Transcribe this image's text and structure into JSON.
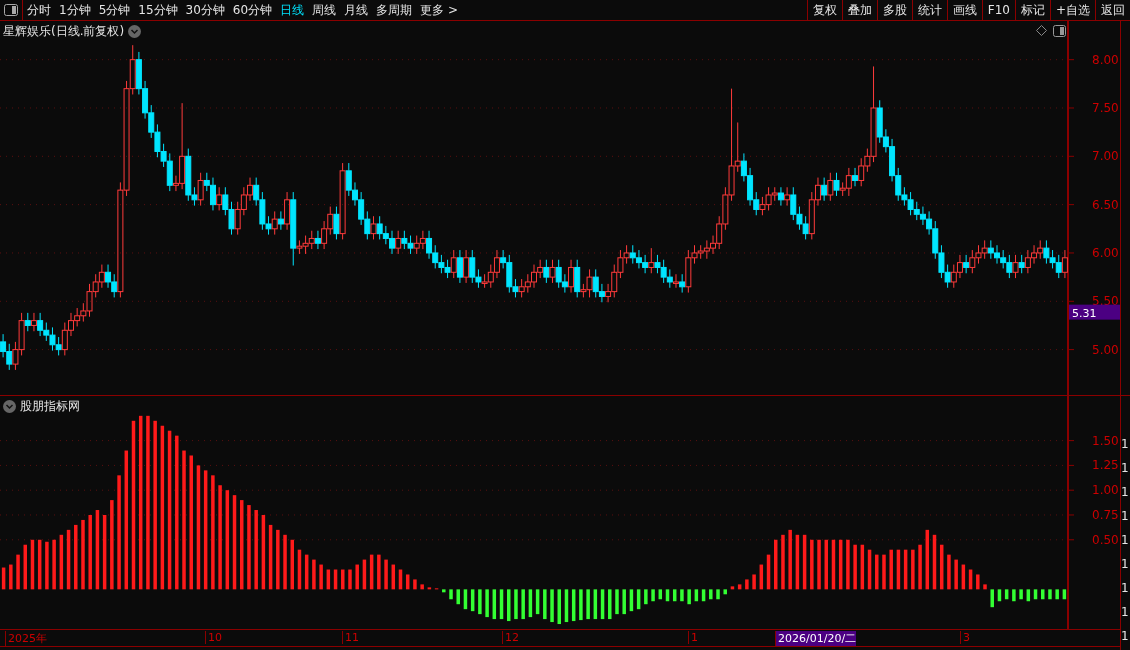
{
  "toolbar": {
    "periods": [
      {
        "label": "分时",
        "selected": false
      },
      {
        "label": "1分钟",
        "selected": false
      },
      {
        "label": "5分钟",
        "selected": false
      },
      {
        "label": "15分钟",
        "selected": false
      },
      {
        "label": "30分钟",
        "selected": false
      },
      {
        "label": "60分钟",
        "selected": false
      },
      {
        "label": "日线",
        "selected": true
      },
      {
        "label": "周线",
        "selected": false
      },
      {
        "label": "月线",
        "selected": false
      },
      {
        "label": "多周期",
        "selected": false
      },
      {
        "label": "更多 >",
        "selected": false
      }
    ],
    "buttons": [
      "复权",
      "叠加",
      "多股",
      "统计",
      "画线",
      "F10",
      "标记",
      "+自选",
      "返回"
    ]
  },
  "main_chart": {
    "title": "星辉娱乐(日线.前复权)",
    "price_tag": "5.31",
    "chart_data": {
      "type": "candlestick",
      "grid": true,
      "ylim": [
        4.52,
        8.4
      ],
      "yticks": [
        {
          "value": 8,
          "label": "8.00"
        },
        {
          "value": 7.5,
          "label": "7.50"
        },
        {
          "value": 7,
          "label": "7.00"
        },
        {
          "value": 6.5,
          "label": "6.50"
        },
        {
          "value": 6,
          "label": "6.00"
        },
        {
          "value": 5.5,
          "label": "5.50"
        },
        {
          "value": 5,
          "label": "5.00"
        }
      ],
      "ohlc": [
        [
          5.08,
          5.16,
          4.92,
          4.98
        ],
        [
          4.98,
          5.06,
          4.79,
          4.85
        ],
        [
          4.85,
          5.08,
          4.79,
          5.0
        ],
        [
          5.0,
          5.38,
          4.94,
          5.3
        ],
        [
          5.3,
          5.38,
          5.19,
          5.25
        ],
        [
          5.25,
          5.38,
          5.19,
          5.3
        ],
        [
          5.3,
          5.38,
          5.14,
          5.2
        ],
        [
          5.2,
          5.28,
          5.09,
          5.15
        ],
        [
          5.15,
          5.23,
          4.99,
          5.05
        ],
        [
          5.05,
          5.13,
          4.94,
          5.0
        ],
        [
          5.0,
          5.28,
          4.94,
          5.2
        ],
        [
          5.2,
          5.38,
          5.14,
          5.3
        ],
        [
          5.3,
          5.43,
          5.24,
          5.35
        ],
        [
          5.35,
          5.48,
          5.29,
          5.4
        ],
        [
          5.4,
          5.68,
          5.34,
          5.6
        ],
        [
          5.6,
          5.78,
          5.54,
          5.7
        ],
        [
          5.7,
          5.88,
          5.64,
          5.8
        ],
        [
          5.8,
          5.88,
          5.64,
          5.7
        ],
        [
          5.7,
          5.78,
          5.54,
          5.6
        ],
        [
          5.6,
          6.73,
          5.54,
          6.65
        ],
        [
          6.65,
          7.78,
          6.59,
          7.7
        ],
        [
          7.7,
          8.15,
          7.64,
          8.0
        ],
        [
          8.0,
          8.08,
          7.64,
          7.7
        ],
        [
          7.7,
          7.78,
          7.39,
          7.45
        ],
        [
          7.45,
          7.53,
          7.19,
          7.25
        ],
        [
          7.25,
          7.33,
          6.99,
          7.05
        ],
        [
          7.05,
          7.13,
          6.89,
          6.95
        ],
        [
          6.95,
          7.03,
          6.64,
          6.7
        ],
        [
          6.7,
          6.8,
          6.64,
          6.72
        ],
        [
          6.72,
          7.55,
          6.66,
          7.0
        ],
        [
          7.0,
          7.08,
          6.54,
          6.6
        ],
        [
          6.6,
          6.68,
          6.49,
          6.55
        ],
        [
          6.55,
          6.83,
          6.49,
          6.75
        ],
        [
          6.75,
          6.83,
          6.64,
          6.7
        ],
        [
          6.7,
          6.78,
          6.44,
          6.5
        ],
        [
          6.5,
          6.68,
          6.44,
          6.6
        ],
        [
          6.6,
          6.68,
          6.39,
          6.45
        ],
        [
          6.45,
          6.53,
          6.19,
          6.25
        ],
        [
          6.25,
          6.53,
          6.19,
          6.45
        ],
        [
          6.45,
          6.68,
          6.39,
          6.6
        ],
        [
          6.6,
          6.78,
          6.54,
          6.7
        ],
        [
          6.7,
          6.78,
          6.49,
          6.55
        ],
        [
          6.55,
          6.63,
          6.24,
          6.3
        ],
        [
          6.3,
          6.38,
          6.19,
          6.25
        ],
        [
          6.25,
          6.43,
          6.19,
          6.35
        ],
        [
          6.35,
          6.43,
          6.24,
          6.3
        ],
        [
          6.3,
          6.63,
          6.24,
          6.55
        ],
        [
          6.55,
          6.63,
          5.87,
          6.05
        ],
        [
          6.05,
          6.13,
          5.99,
          6.07
        ],
        [
          6.07,
          6.18,
          5.99,
          6.1
        ],
        [
          6.1,
          6.23,
          6.04,
          6.15
        ],
        [
          6.15,
          6.23,
          6.04,
          6.1
        ],
        [
          6.1,
          6.33,
          6.04,
          6.25
        ],
        [
          6.25,
          6.48,
          6.19,
          6.4
        ],
        [
          6.4,
          6.48,
          6.14,
          6.2
        ],
        [
          6.2,
          6.93,
          6.14,
          6.85
        ],
        [
          6.85,
          6.93,
          6.59,
          6.65
        ],
        [
          6.65,
          6.73,
          6.49,
          6.55
        ],
        [
          6.55,
          6.63,
          6.29,
          6.35
        ],
        [
          6.35,
          6.43,
          6.14,
          6.2
        ],
        [
          6.2,
          6.38,
          6.14,
          6.3
        ],
        [
          6.3,
          6.38,
          6.14,
          6.2
        ],
        [
          6.2,
          6.28,
          6.09,
          6.15
        ],
        [
          6.15,
          6.23,
          5.99,
          6.05
        ],
        [
          6.05,
          6.23,
          5.99,
          6.15
        ],
        [
          6.15,
          6.23,
          6.04,
          6.1
        ],
        [
          6.1,
          6.18,
          5.99,
          6.05
        ],
        [
          6.05,
          6.18,
          5.99,
          6.1
        ],
        [
          6.1,
          6.23,
          6.04,
          6.15
        ],
        [
          6.15,
          6.23,
          5.94,
          6.0
        ],
        [
          6.0,
          6.08,
          5.84,
          5.9
        ],
        [
          5.9,
          5.98,
          5.79,
          5.85
        ],
        [
          5.85,
          5.93,
          5.74,
          5.8
        ],
        [
          5.8,
          6.03,
          5.74,
          5.95
        ],
        [
          5.95,
          6.03,
          5.69,
          5.75
        ],
        [
          5.75,
          6.03,
          5.69,
          5.95
        ],
        [
          5.95,
          6.03,
          5.69,
          5.75
        ],
        [
          5.75,
          5.83,
          5.64,
          5.7
        ],
        [
          5.7,
          5.78,
          5.64,
          5.7
        ],
        [
          5.7,
          5.88,
          5.64,
          5.8
        ],
        [
          5.8,
          6.03,
          5.74,
          5.95
        ],
        [
          5.95,
          6.03,
          5.84,
          5.9
        ],
        [
          5.9,
          5.98,
          5.59,
          5.65
        ],
        [
          5.65,
          5.73,
          5.54,
          5.6
        ],
        [
          5.6,
          5.73,
          5.54,
          5.65
        ],
        [
          5.65,
          5.78,
          5.59,
          5.7
        ],
        [
          5.7,
          5.88,
          5.64,
          5.8
        ],
        [
          5.8,
          5.93,
          5.74,
          5.85
        ],
        [
          5.85,
          5.93,
          5.69,
          5.75
        ],
        [
          5.75,
          5.93,
          5.69,
          5.85
        ],
        [
          5.85,
          5.93,
          5.64,
          5.7
        ],
        [
          5.7,
          5.78,
          5.59,
          5.65
        ],
        [
          5.65,
          5.93,
          5.59,
          5.85
        ],
        [
          5.85,
          5.93,
          5.54,
          5.6
        ],
        [
          5.6,
          5.68,
          5.54,
          5.62
        ],
        [
          5.62,
          5.83,
          5.54,
          5.75
        ],
        [
          5.75,
          5.83,
          5.54,
          5.6
        ],
        [
          5.6,
          5.68,
          5.49,
          5.55
        ],
        [
          5.55,
          5.68,
          5.49,
          5.6
        ],
        [
          5.6,
          5.88,
          5.54,
          5.8
        ],
        [
          5.8,
          6.03,
          5.74,
          5.95
        ],
        [
          5.95,
          6.08,
          5.89,
          6.0
        ],
        [
          6.0,
          6.08,
          5.89,
          5.95
        ],
        [
          5.95,
          6.03,
          5.84,
          5.9
        ],
        [
          5.9,
          5.98,
          5.79,
          5.85
        ],
        [
          5.85,
          6.05,
          5.79,
          5.9
        ],
        [
          5.9,
          5.98,
          5.79,
          5.85
        ],
        [
          5.85,
          5.93,
          5.69,
          5.75
        ],
        [
          5.75,
          5.83,
          5.64,
          5.7
        ],
        [
          5.7,
          5.78,
          5.64,
          5.7
        ],
        [
          5.7,
          5.78,
          5.59,
          5.65
        ],
        [
          5.65,
          6.03,
          5.59,
          5.95
        ],
        [
          5.95,
          6.08,
          5.89,
          6.0
        ],
        [
          6.0,
          6.08,
          5.94,
          6.02
        ],
        [
          6.02,
          6.13,
          5.94,
          6.05
        ],
        [
          6.05,
          6.18,
          5.99,
          6.1
        ],
        [
          6.1,
          6.38,
          6.04,
          6.3
        ],
        [
          6.3,
          6.68,
          6.24,
          6.6
        ],
        [
          6.6,
          7.7,
          6.54,
          6.9
        ],
        [
          6.9,
          7.35,
          6.84,
          6.95
        ],
        [
          6.95,
          7.03,
          6.74,
          6.8
        ],
        [
          6.8,
          6.88,
          6.49,
          6.55
        ],
        [
          6.55,
          6.63,
          6.39,
          6.45
        ],
        [
          6.45,
          6.58,
          6.39,
          6.5
        ],
        [
          6.5,
          6.68,
          6.44,
          6.6
        ],
        [
          6.6,
          6.68,
          6.54,
          6.62
        ],
        [
          6.62,
          6.68,
          6.49,
          6.55
        ],
        [
          6.55,
          6.68,
          6.49,
          6.6
        ],
        [
          6.6,
          6.68,
          6.34,
          6.4
        ],
        [
          6.4,
          6.48,
          6.24,
          6.3
        ],
        [
          6.3,
          6.38,
          6.14,
          6.2
        ],
        [
          6.2,
          6.63,
          6.14,
          6.55
        ],
        [
          6.55,
          6.78,
          6.49,
          6.7
        ],
        [
          6.7,
          6.78,
          6.54,
          6.6
        ],
        [
          6.6,
          6.83,
          6.54,
          6.75
        ],
        [
          6.75,
          6.83,
          6.59,
          6.65
        ],
        [
          6.65,
          6.73,
          6.59,
          6.67
        ],
        [
          6.67,
          6.88,
          6.59,
          6.8
        ],
        [
          6.8,
          6.88,
          6.69,
          6.75
        ],
        [
          6.75,
          6.98,
          6.69,
          6.9
        ],
        [
          6.9,
          7.08,
          6.84,
          7.0
        ],
        [
          7.0,
          7.93,
          6.94,
          7.5
        ],
        [
          7.5,
          7.58,
          7.14,
          7.2
        ],
        [
          7.2,
          7.28,
          7.04,
          7.1
        ],
        [
          7.1,
          7.18,
          6.74,
          6.8
        ],
        [
          6.8,
          6.88,
          6.54,
          6.6
        ],
        [
          6.6,
          6.68,
          6.49,
          6.55
        ],
        [
          6.55,
          6.63,
          6.39,
          6.45
        ],
        [
          6.45,
          6.53,
          6.34,
          6.4
        ],
        [
          6.4,
          6.48,
          6.29,
          6.35
        ],
        [
          6.35,
          6.43,
          6.19,
          6.25
        ],
        [
          6.25,
          6.33,
          5.94,
          6.0
        ],
        [
          6.0,
          6.08,
          5.74,
          5.8
        ],
        [
          5.8,
          5.88,
          5.64,
          5.7
        ],
        [
          5.7,
          5.88,
          5.64,
          5.8
        ],
        [
          5.8,
          5.98,
          5.74,
          5.9
        ],
        [
          5.9,
          5.98,
          5.79,
          5.85
        ],
        [
          5.85,
          6.03,
          5.79,
          5.95
        ],
        [
          5.95,
          6.08,
          5.89,
          6.0
        ],
        [
          6.0,
          6.13,
          5.94,
          6.05
        ],
        [
          6.05,
          6.13,
          5.94,
          6.0
        ],
        [
          6.0,
          6.08,
          5.89,
          5.95
        ],
        [
          5.95,
          6.03,
          5.84,
          5.9
        ],
        [
          5.9,
          5.98,
          5.74,
          5.8
        ],
        [
          5.8,
          5.98,
          5.74,
          5.9
        ],
        [
          5.9,
          5.98,
          5.79,
          5.85
        ],
        [
          5.85,
          6.03,
          5.79,
          5.95
        ],
        [
          5.95,
          6.08,
          5.89,
          6.0
        ],
        [
          6.0,
          6.13,
          5.94,
          6.05
        ],
        [
          6.05,
          6.13,
          5.89,
          5.95
        ],
        [
          5.95,
          6.03,
          5.84,
          5.9
        ],
        [
          5.9,
          5.98,
          5.74,
          5.8
        ],
        [
          5.8,
          6.03,
          5.74,
          5.95
        ]
      ]
    }
  },
  "indicator_chart": {
    "title": "股朋指标网",
    "chart_data": {
      "type": "bar",
      "grid": true,
      "ylim": [
        -0.4,
        1.95
      ],
      "yticks": [
        {
          "value": 1.5,
          "label": "1.50"
        },
        {
          "value": 1.25,
          "label": "1.25"
        },
        {
          "value": 1,
          "label": "1.00"
        },
        {
          "value": 0.75,
          "label": "0.75"
        },
        {
          "value": 0.5,
          "label": "0.50"
        }
      ],
      "values": [
        0.22,
        0.25,
        0.35,
        0.45,
        0.5,
        0.5,
        0.48,
        0.5,
        0.55,
        0.6,
        0.65,
        0.7,
        0.75,
        0.8,
        0.75,
        0.9,
        1.15,
        1.4,
        1.7,
        1.75,
        1.75,
        1.7,
        1.65,
        1.6,
        1.55,
        1.4,
        1.35,
        1.25,
        1.2,
        1.15,
        1.05,
        1.0,
        0.95,
        0.9,
        0.85,
        0.8,
        0.75,
        0.65,
        0.6,
        0.55,
        0.5,
        0.4,
        0.35,
        0.3,
        0.25,
        0.2,
        0.2,
        0.2,
        0.2,
        0.25,
        0.3,
        0.35,
        0.35,
        0.3,
        0.25,
        0.2,
        0.15,
        0.1,
        0.05,
        0.02,
        0.01,
        -0.03,
        -0.1,
        -0.15,
        -0.2,
        -0.22,
        -0.25,
        -0.28,
        -0.3,
        -0.3,
        -0.32,
        -0.3,
        -0.3,
        -0.28,
        -0.25,
        -0.3,
        -0.33,
        -0.35,
        -0.33,
        -0.32,
        -0.31,
        -0.3,
        -0.3,
        -0.3,
        -0.3,
        -0.25,
        -0.25,
        -0.22,
        -0.2,
        -0.15,
        -0.12,
        -0.1,
        -0.12,
        -0.12,
        -0.12,
        -0.15,
        -0.12,
        -0.12,
        -0.1,
        -0.1,
        -0.05,
        0.03,
        0.05,
        0.1,
        0.15,
        0.25,
        0.35,
        0.5,
        0.55,
        0.6,
        0.55,
        0.55,
        0.5,
        0.5,
        0.5,
        0.5,
        0.5,
        0.5,
        0.45,
        0.45,
        0.4,
        0.35,
        0.35,
        0.4,
        0.4,
        0.4,
        0.4,
        0.45,
        0.6,
        0.55,
        0.45,
        0.35,
        0.3,
        0.25,
        0.2,
        0.15,
        0.05,
        -0.18,
        -0.12,
        -0.1,
        -0.12,
        -0.1,
        -0.12,
        -0.1,
        -0.1,
        -0.1,
        -0.1,
        -0.1
      ]
    }
  },
  "time_axis": [
    {
      "label": "2025年",
      "selected": false
    },
    {
      "label": "10",
      "selected": false
    },
    {
      "label": "11",
      "selected": false
    },
    {
      "label": "12",
      "selected": false
    },
    {
      "label": "1",
      "selected": false
    },
    {
      "label": "2026/01/20/二",
      "selected": true
    },
    {
      "label": "3",
      "selected": false
    }
  ],
  "side_strip": [
    "1",
    "1",
    "1",
    "1",
    "1",
    "1",
    "1",
    "1",
    "1"
  ]
}
